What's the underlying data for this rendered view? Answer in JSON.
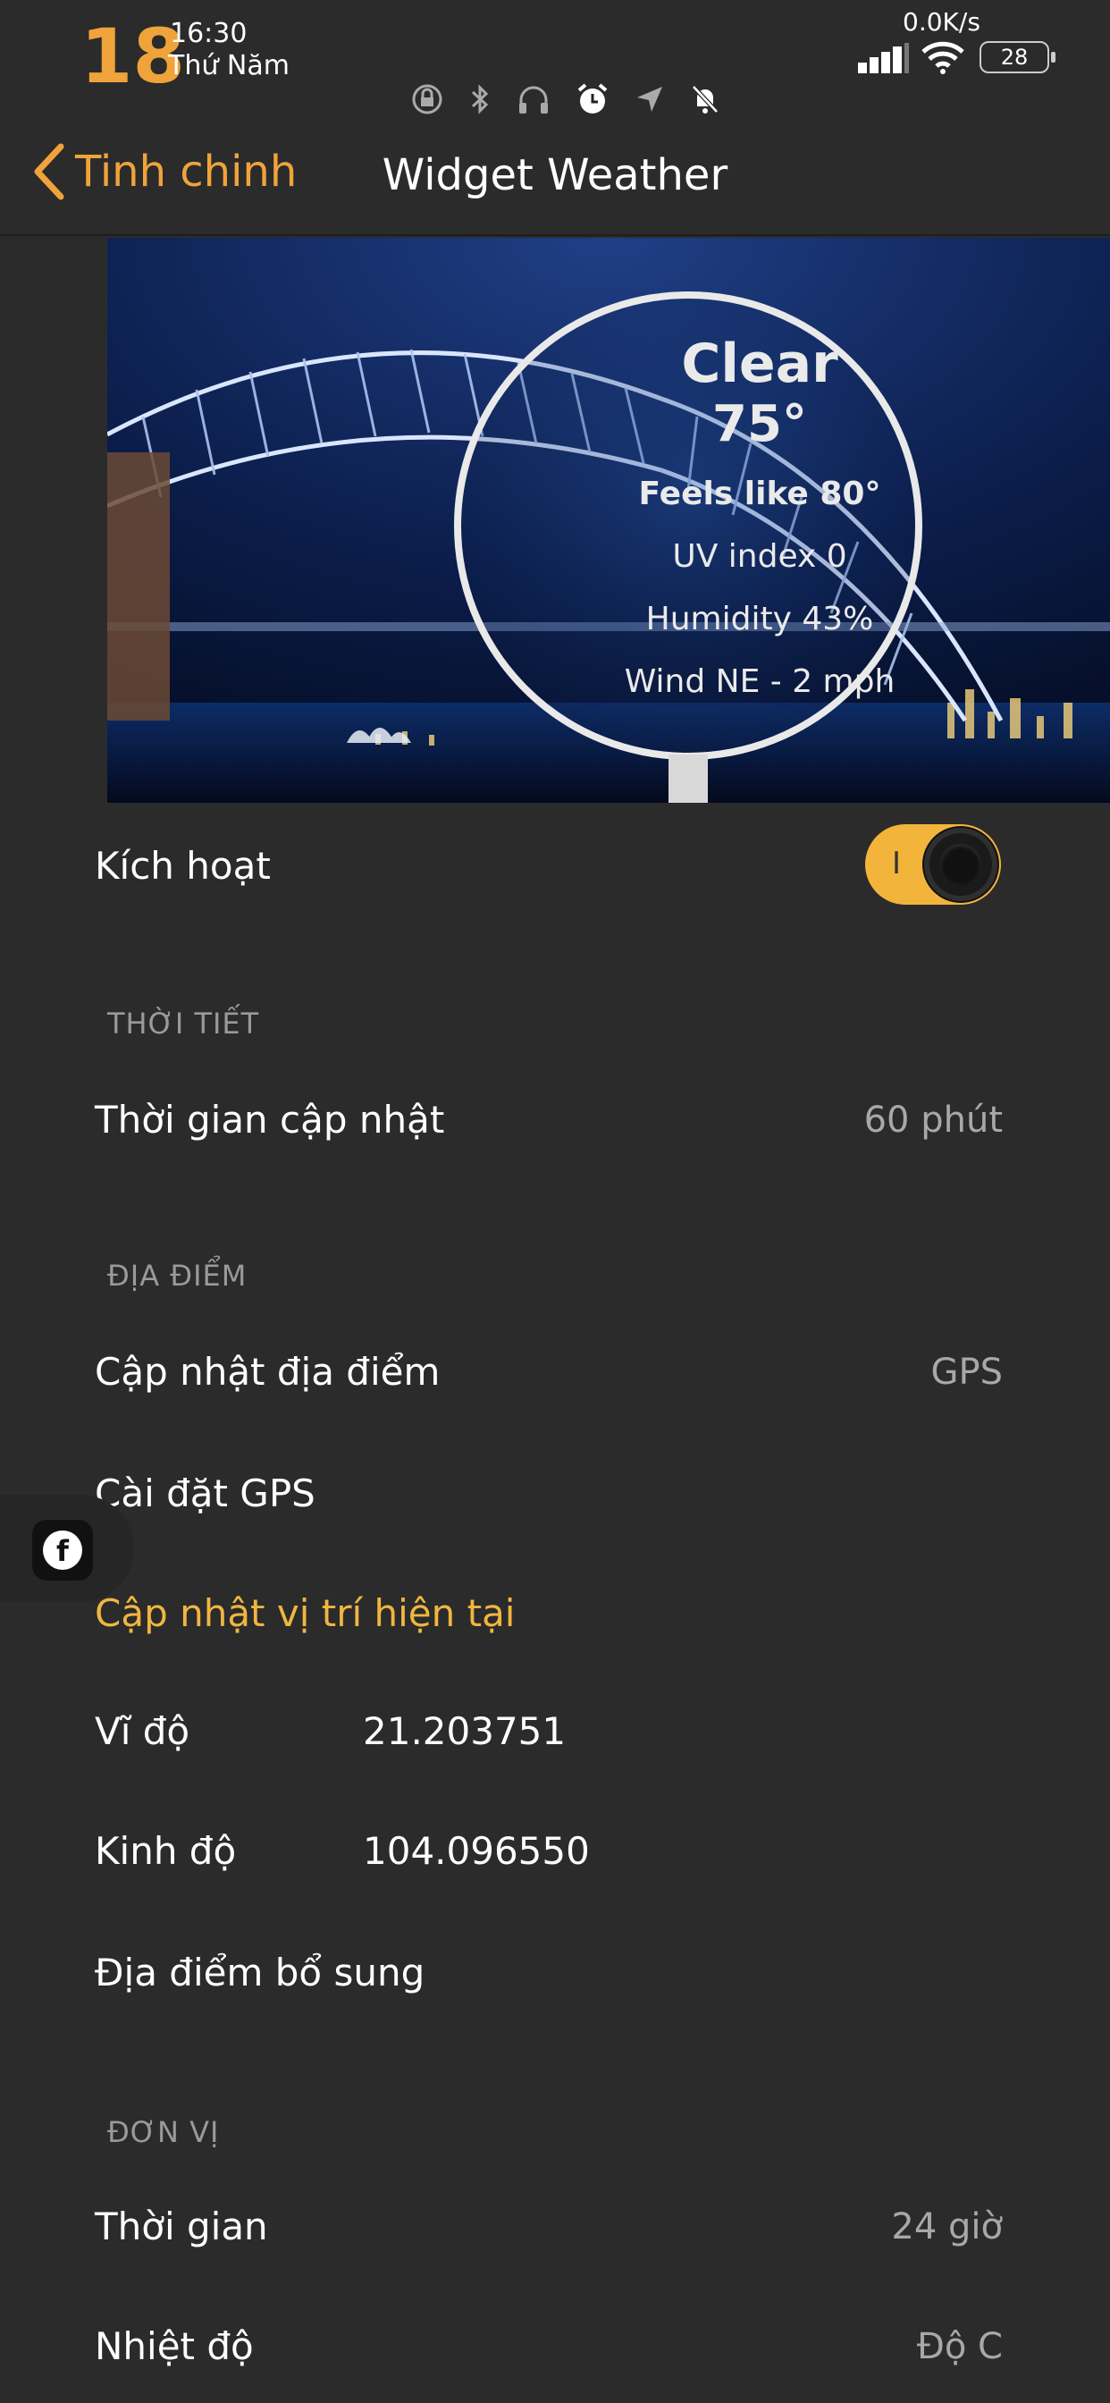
{
  "status_bar": {
    "day": "18",
    "time": "16:30",
    "weekday": "Thứ Năm",
    "net_speed": "0.0K/s",
    "battery": "28"
  },
  "nav": {
    "back_label": "Tinh chinh",
    "title": "Widget Weather"
  },
  "banner": {
    "condition": "Clear",
    "temperature": "75°",
    "feels_like": "Feels like 80°",
    "uv": "UV index 0",
    "humidity": "Humidity 43%",
    "wind": "Wind NE - 2 mph"
  },
  "enable": {
    "label": "Kích hoạt",
    "toggle_mark": "I",
    "on": true
  },
  "weather_section": {
    "header": "THỜI TIẾT",
    "update_label": "Thời gian cập nhật",
    "update_value": "60 phút"
  },
  "location_section": {
    "header": "ĐỊA ĐIỂM",
    "update_label": "Cập nhật địa điểm",
    "update_value": "GPS",
    "gps_settings": "Cài đặt GPS",
    "refresh_current": "Cập nhật vị trí hiện tại",
    "latitude_label": "Vĩ độ",
    "latitude_value": "21.203751",
    "longitude_label": "Kinh độ",
    "longitude_value": "104.096550",
    "extra_locations": "Địa điểm bổ sung"
  },
  "units_section": {
    "header": "ĐƠN VỊ",
    "time_label": "Thời gian",
    "time_value": "24 giờ",
    "temp_label": "Nhiệt độ",
    "temp_value": "Độ C"
  },
  "floating": {
    "icon": "facebook-icon",
    "glyph": "f"
  },
  "colors": {
    "accent": "#f0a33b",
    "background": "#2b2b2b",
    "toggle_on": "#f2b43a"
  }
}
